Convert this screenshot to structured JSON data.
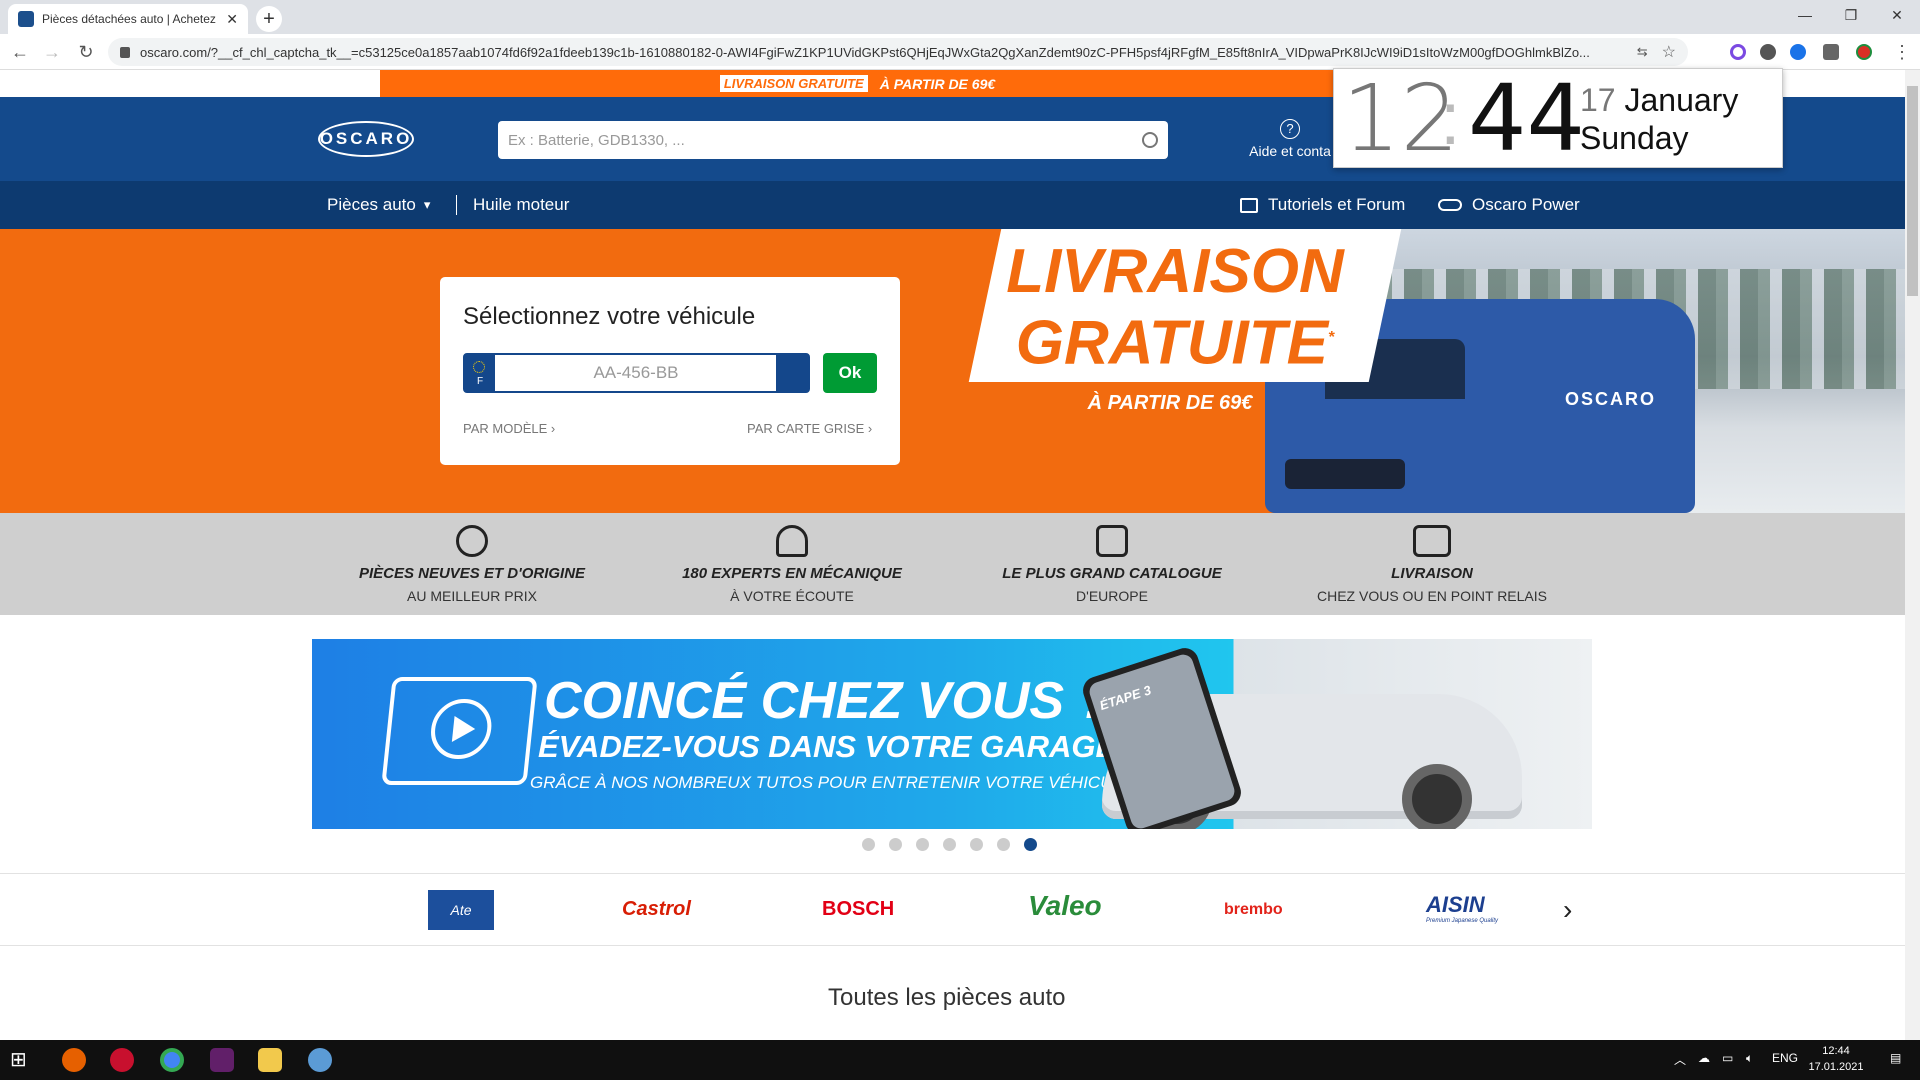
{
  "browser": {
    "tab_title": "Pièces détachées auto | Achetez",
    "url": "oscaro.com/?__cf_chl_captcha_tk__=c53125ce0a1857aab1074fd6f92a1fdeeb139c1b-1610880182-0-AWI4FgiFwZ1KP1UVidGKPst6QHjEqJWxGta2QgXanZdemt90zC-PFH5psf4jRFgfM_E85ft8nIrA_VIDpwaPrK8IJcWI9iD1sItoWzM00gfDOGhlmkBlZo..."
  },
  "promo": {
    "badge": "LIVRAISON GRATUITE",
    "text": "À PARTIR DE 69€"
  },
  "header": {
    "logo": "OSCARO",
    "search_placeholder": "Ex : Batterie, GDB1330, ...",
    "help_label": "Aide et conta"
  },
  "clock": {
    "hours": "12",
    "minutes": "44",
    "date_line": "17 January",
    "day": "Sunday",
    "date_num": "17",
    "month": "January"
  },
  "nav": {
    "pieces": "Pièces auto",
    "huile": "Huile moteur",
    "tutos": "Tutoriels et Forum",
    "power": "Oscaro Power"
  },
  "hero": {
    "title": "Sélectionnez votre véhicule",
    "plate_country": "F",
    "plate_placeholder": "AA-456-BB",
    "ok": "Ok",
    "par_modele": "PAR MODÈLE",
    "par_carte": "PAR CARTE GRISE",
    "promo_line1": "LIVRAISON",
    "promo_line2": "GRATUITE",
    "promo_star": "*",
    "promo_sub": "À PARTIR DE 69€",
    "van_logo": "OSCARO"
  },
  "usp": [
    {
      "title": "PIÈCES NEUVES ET D'ORIGINE",
      "sub": "AU MEILLEUR PRIX",
      "icon": "medal-icon"
    },
    {
      "title": "180 EXPERTS EN MÉCANIQUE",
      "sub": "À VOTRE ÉCOUTE",
      "icon": "headset-icon"
    },
    {
      "title": "LE PLUS GRAND CATALOGUE",
      "sub": "D'EUROPE",
      "icon": "catalog-icon"
    },
    {
      "title": "LIVRAISON",
      "sub": "CHEZ VOUS OU EN POINT RELAIS",
      "icon": "truck-icon"
    }
  ],
  "banner": {
    "line1": "COINCÉ CHEZ VOUS ?",
    "line2": "ÉVADEZ-VOUS DANS VOTRE GARAGE !",
    "line3": "GRÂCE À NOS NOMBREUX TUTOS POUR ENTRETENIR VOTRE VÉHICULE",
    "etape": "ÉTAPE 3"
  },
  "carousel": {
    "count": 7,
    "active": 7
  },
  "brands": [
    "Ate",
    "Castrol",
    "BOSCH",
    "Valeo",
    "brembo",
    "AISIN"
  ],
  "brand_sub": "Premium Japanese Quality",
  "section_title": "Toutes les pièces auto",
  "taskbar": {
    "time": "12:44",
    "date": "17.01.2021",
    "lang": "ENG"
  },
  "colors": {
    "orange": "#f26b0f",
    "blue": "#144a8c",
    "navy": "#0d3a70",
    "green": "#009b34"
  }
}
